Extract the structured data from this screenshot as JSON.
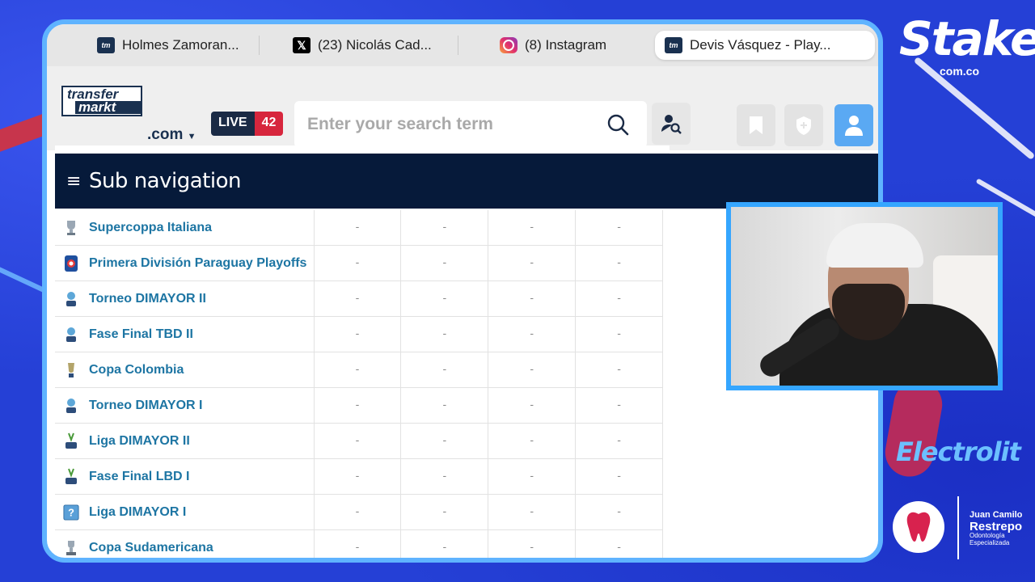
{
  "tabs": [
    {
      "favicon": "tm",
      "title": "Holmes Zamoran...",
      "active": false
    },
    {
      "favicon": "x",
      "title": "(23) Nicolás Cad...",
      "active": false
    },
    {
      "favicon": "instagram",
      "title": "(8) Instagram",
      "active": false
    },
    {
      "favicon": "tm",
      "title": "Devis Vásquez - Play...",
      "active": true
    }
  ],
  "header": {
    "logo_top": "transfer",
    "logo_bottom": "markt",
    "domain": ".com",
    "live_label": "LIVE",
    "live_count": "42",
    "search_placeholder": "Enter your search term"
  },
  "subnav": {
    "icon": "≡",
    "label": "Sub navigation"
  },
  "table": {
    "rows": [
      {
        "name": "Supercoppa Italiana",
        "icon": "trophy-icon",
        "values": [
          "-",
          "-",
          "-",
          "-"
        ]
      },
      {
        "name": "Primera División Paraguay Playoffs",
        "icon": "league-badge-icon",
        "values": [
          "-",
          "-",
          "-",
          "-"
        ]
      },
      {
        "name": "Torneo DIMAYOR II",
        "icon": "dimayor-icon",
        "values": [
          "-",
          "-",
          "-",
          "-"
        ]
      },
      {
        "name": "Fase Final TBD II",
        "icon": "dimayor-icon",
        "values": [
          "-",
          "-",
          "-",
          "-"
        ]
      },
      {
        "name": "Copa Colombia",
        "icon": "cup-icon",
        "values": [
          "-",
          "-",
          "-",
          "-"
        ]
      },
      {
        "name": "Torneo DIMAYOR I",
        "icon": "dimayor-icon",
        "values": [
          "-",
          "-",
          "-",
          "-"
        ]
      },
      {
        "name": "Liga DIMAYOR II",
        "icon": "betplay-icon",
        "values": [
          "-",
          "-",
          "-",
          "-"
        ]
      },
      {
        "name": "Fase Final LBD I",
        "icon": "betplay-icon",
        "values": [
          "-",
          "-",
          "-",
          "-"
        ]
      },
      {
        "name": "Liga DIMAYOR I",
        "icon": "unknown-badge-icon",
        "values": [
          "-",
          "-",
          "-",
          "-"
        ]
      },
      {
        "name": "Copa Sudamericana",
        "icon": "sudamericana-icon",
        "values": [
          "-",
          "-",
          "-",
          "-"
        ]
      }
    ]
  },
  "overlay": {
    "stake_logo": "Stake",
    "stake_domain": "com.co",
    "electrolit_logo": "Electrolit",
    "dentist_line1": "Juan Camilo",
    "dentist_line2": "Restrepo",
    "dentist_line3": "Odontología",
    "dentist_line4": "Especializada"
  },
  "colors": {
    "accent": "#5aa9f3",
    "navy": "#061a3a",
    "link": "#1d75a3",
    "live_red": "#d7263d",
    "stream_bg": "#2540d6"
  }
}
